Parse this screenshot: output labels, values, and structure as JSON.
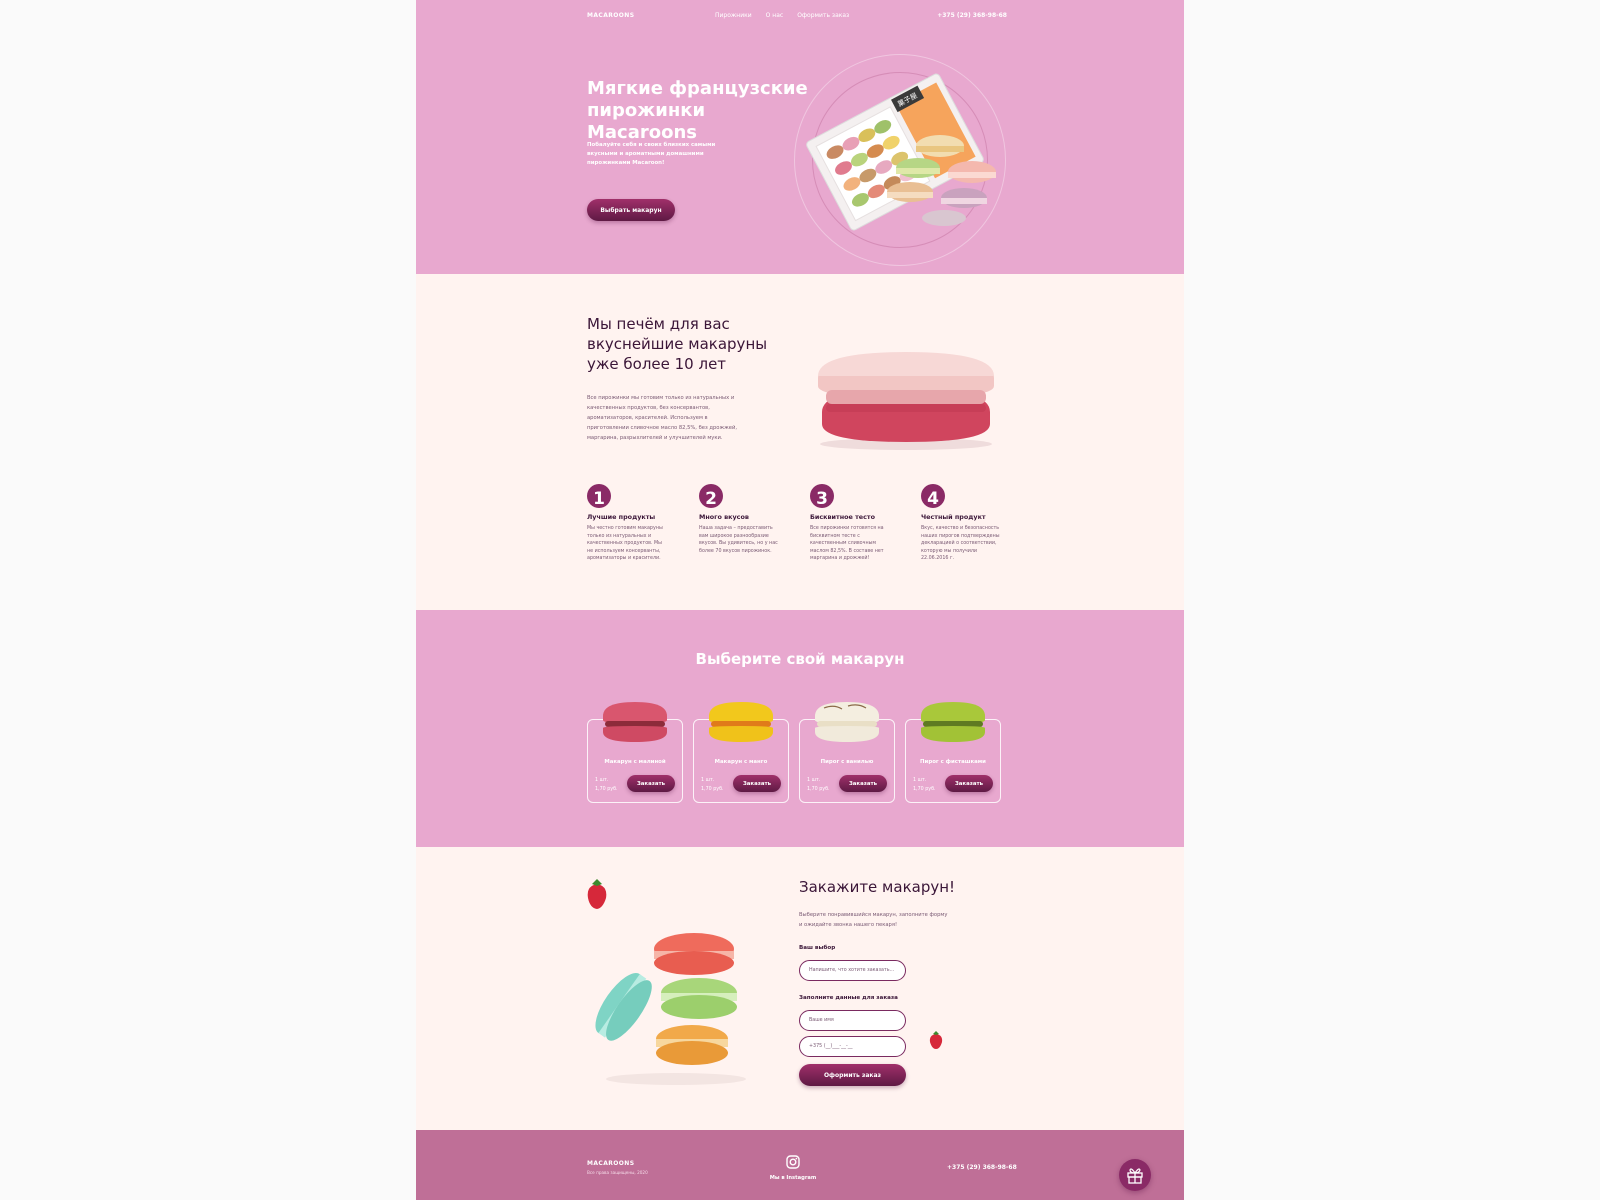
{
  "nav": {
    "logo": "MACAROONS",
    "links": [
      "Пирожники",
      "О нас",
      "Оформить заказ"
    ],
    "phone": "+375 (29) 368-98-68"
  },
  "hero": {
    "title": "Мягкие французские пирожинки Macaroons",
    "subtitle": "Побалуйте себя и своих близких самыми вкусными и ароматными домашними пирожинками Macaroon!",
    "cta": "Выбрать макарун",
    "box_label": "菓子屋"
  },
  "about": {
    "title": "Мы печём для вас вкуснейшие макаруны уже более 10 лет",
    "description": "Все пирожинки мы готовим только из натуральных и качественных продуктов, без консервантов, ароматизаторов, красителей. Используем в приготовлении сливочное масло 82,5%, без дрожжей, маргарина, разрыхлителей и улучшителей муки.",
    "features": [
      {
        "num": "1",
        "title": "Лучшие продукты",
        "text": "Мы честно готовим макаруны только из натуральных и качественных продуктов. Мы не используем консерванты, ароматизаторы и красители."
      },
      {
        "num": "2",
        "title": "Много вкусов",
        "text": "Наша задача – предоставить вам широкое разнообразие вкусов. Вы удивитесь, но у нас более 70 вкусов пирожинок."
      },
      {
        "num": "3",
        "title": "Бисквитное тесто",
        "text": "Все пирожинки готовятся на бисквитном тесте с качественным сливочным маслом 82,5%. В составе нет маргарина и дрожжей!"
      },
      {
        "num": "4",
        "title": "Честный продукт",
        "text": "Вкус, качество и безопасность наших пирогов подтверждены декларацией о соответствии, которую мы получили 22.06.2016 г."
      }
    ]
  },
  "choose": {
    "title": "Выберите свой макарун",
    "order_label": "Заказать",
    "products": [
      {
        "name": "Макарун с малиной",
        "qty": "1 шт.",
        "price": "1,70 руб.",
        "color": "#d9566e"
      },
      {
        "name": "Макарун с манго",
        "qty": "1 шт.",
        "price": "1,70 руб.",
        "color": "#f2c81c"
      },
      {
        "name": "Пирог с ванилью",
        "qty": "1 шт.",
        "price": "1,70 руб.",
        "color": "#f4eee0"
      },
      {
        "name": "Пирог с фисташками",
        "qty": "1 шт.",
        "price": "1,70 руб.",
        "color": "#a9c83a"
      }
    ]
  },
  "order": {
    "title": "Закажите макарун!",
    "description": "Выберите понравившийся макарун, заполните форму и ожидайте звонка нашего пекаря!",
    "choice_label": "Ваш выбор",
    "choice_placeholder": "Напишите, что хотите заказать...",
    "data_label": "Заполните данные для заказа",
    "name_placeholder": "Ваше имя",
    "phone_placeholder": "+375 (__)___-__-__",
    "submit": "Оформить заказ"
  },
  "footer": {
    "logo": "MACAROONS",
    "copyright": "Все права защищены, 2020",
    "instagram": "Мы в Instagram",
    "phone": "+375 (29) 368-98-68"
  },
  "colors": {
    "pink": "#e8a8cf",
    "cream": "#fff3f0",
    "plum": "#8a2a66",
    "footer": "#bf6f97"
  }
}
